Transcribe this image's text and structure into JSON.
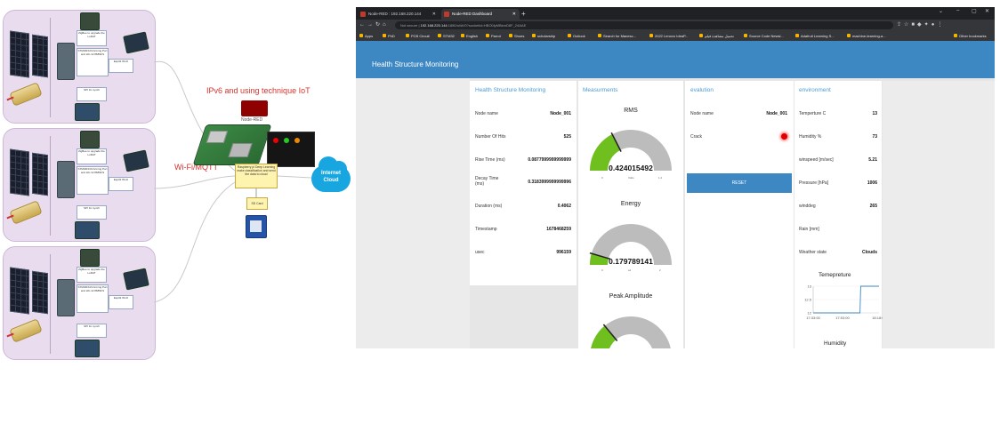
{
  "diagram": {
    "node_labels": {
      "zigbee": "ZigBee to upgrade the LoRAT",
      "board": "STM32F103 Arming Port and HC-12 868SFS",
      "esp": "Esp32 Wi-Fi",
      "sensor": "SPI for synch"
    },
    "label_ipv6": "IPv6 and using technique IoT",
    "label_wifi": "Wi-Fi/MQTT",
    "node_red_logo_text": "Node-RED",
    "rpi_box_text": "Raspberry pi Deep Learning make classification and send the data to cloud",
    "sd_box_text": "SD Card",
    "cloud_text": "Internet Cloud"
  },
  "browser": {
    "tabs": [
      "Node-RED : 192.168.220.144",
      "Node-RED Dashboard"
    ],
    "url_prefix": "Not secure",
    "url": "192.168.220.144",
    "url_rest": ":1880/ui/#!/0?socketid=HBO0lyMBkmD8F_24AAE",
    "bookmarks": [
      "Apps",
      "PhD",
      "PCB Circuit",
      "STM32",
      "English",
      "Parrot",
      "Shoes",
      "scholarship",
      "Outlook",
      "Search for Manesc...",
      "2022 Lenovo IdeaP...",
      "تحميل مشاهدة فيلم",
      "Source Code Newsl...",
      "Adafruit Learning S...",
      "machine-learning-a...",
      "Other bookmarks"
    ]
  },
  "dashboard": {
    "header_title": "Health Structure Monitoring",
    "card1": {
      "title": "Health Structure Monitoring",
      "rows": [
        {
          "label": "Node name",
          "value": "Node_001"
        },
        {
          "label": "Number Of Hits",
          "value": "525"
        },
        {
          "label": "Rise Time (ms)",
          "value": "0.0877999999999999"
        },
        {
          "label": "Decay Time (ms)",
          "value": "0.3183999999999996"
        },
        {
          "label": "Duration (ms)",
          "value": "0.4062"
        },
        {
          "label": "Timestamp",
          "value": "1678468259"
        },
        {
          "label": "usec",
          "value": "996159"
        }
      ]
    },
    "measurments": {
      "title": "Measurments",
      "gauges": [
        {
          "name": "RMS",
          "value": "0.424015492",
          "min": "0",
          "max": "1.2",
          "unit": "Volts",
          "fraction": 0.35
        },
        {
          "name": "Energy",
          "value": "0.179789141",
          "min": "0",
          "max": "2",
          "unit": "aJ",
          "fraction": 0.09
        },
        {
          "name": "Peak Amplitude",
          "value": "",
          "min": "",
          "max": "",
          "unit": "",
          "fraction": 0.28
        }
      ]
    },
    "evaluation": {
      "title": "evalution",
      "node_label": "Node name",
      "node_value": "Node_001",
      "crack_label": "Crack",
      "crack_color": "#e00000",
      "reset_label": "RESET"
    },
    "environment": {
      "title": "environment",
      "rows": [
        {
          "label": "Temperture C",
          "value": "13"
        },
        {
          "label": "Humidity %",
          "value": "73"
        },
        {
          "label": "winspeed [m/sec]",
          "value": "5.21"
        },
        {
          "label": "Pressure [hPa]",
          "value": "1006"
        },
        {
          "label": "winddeg",
          "value": "265"
        },
        {
          "label": "Rain [mm]",
          "value": ""
        },
        {
          "label": "Weather state",
          "value": "Clouds"
        }
      ],
      "chart_title": "Temepreture",
      "chart2_title": "Humidity"
    },
    "accent_color": "#3d87c3",
    "gauge_fill_color": "#6fbf1f"
  },
  "chart_data": {
    "type": "line",
    "title": "Temepreture",
    "categories": [
      "17:33:00",
      "17:53:00",
      "18:18:00"
    ],
    "x": [
      "17:33:00",
      "17:53:00",
      "18:05:00",
      "18:05:30",
      "18:18:00"
    ],
    "values": [
      12,
      12,
      12,
      13,
      13
    ],
    "y_ticks": [
      "13",
      "12.5",
      "12"
    ],
    "ylim": [
      12,
      13
    ],
    "line_color": "#3d87c3"
  }
}
